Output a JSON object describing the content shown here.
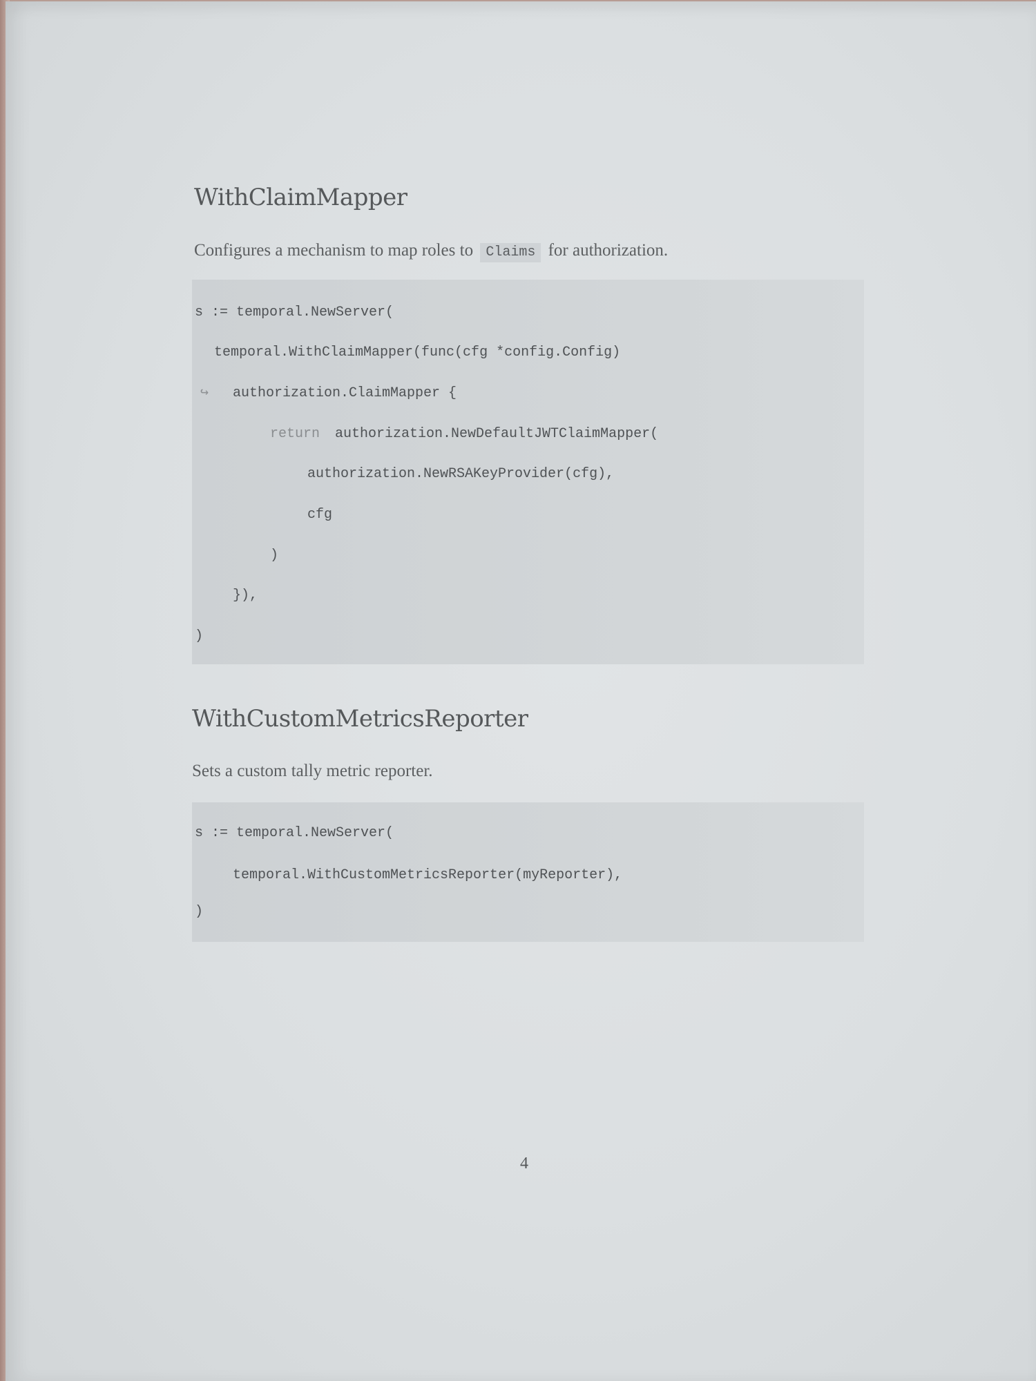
{
  "sections": [
    {
      "title": "WithClaimMapper",
      "description_before": "Configures a mechanism to map roles to",
      "description_code": "Claims",
      "description_after": "for authorization.",
      "code": {
        "l1": "s := temporal.NewServer(",
        "l2": "temporal.WithClaimMapper(func(cfg *config.Config)",
        "l3_arrow": "↪",
        "l3": "authorization.ClaimMapper {",
        "l4_kw": "return",
        "l4": "authorization.NewDefaultJWTClaimMapper(",
        "l5": "authorization.NewRSAKeyProvider(cfg),",
        "l6": "cfg",
        "l7": ")",
        "l8": "}),",
        "l9": ")"
      }
    },
    {
      "title": "WithCustomMetricsReporter",
      "description": "Sets a custom tally metric reporter.",
      "code": {
        "l1": "s := temporal.NewServer(",
        "l2": "temporal.WithCustomMetricsReporter(myReporter),",
        "l3": ")"
      }
    }
  ],
  "page_number": "4"
}
